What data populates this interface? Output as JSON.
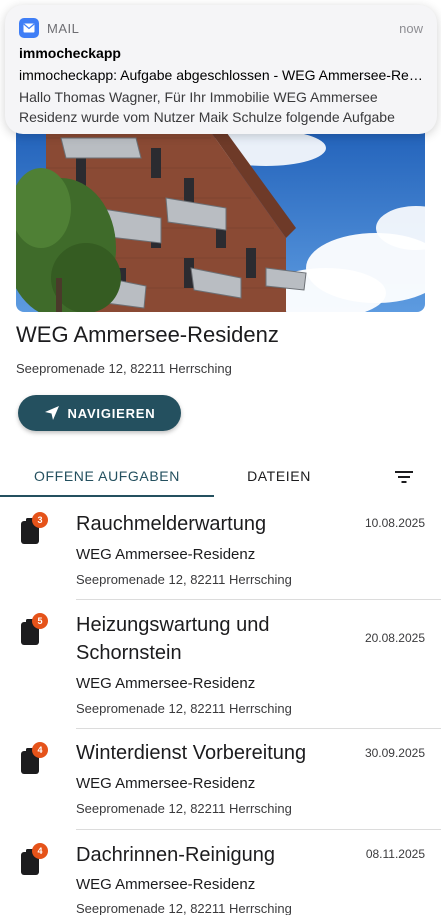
{
  "notification": {
    "app_name": "MAIL",
    "time": "now",
    "sender": "immocheckapp",
    "subject": "immocheckapp: Aufgabe abgeschlossen - WEG Ammersee-Residenz",
    "body": "Hallo Thomas Wagner, Für Ihr Immobilie WEG Ammersee Residenz wurde vom Nutzer Maik Schulze folgende Aufgabe abgeschlossen"
  },
  "property": {
    "name": "WEG Ammersee-Residenz",
    "address": "Seepromenade 12, 82211 Herrsching",
    "navigate_label": "NAVIGIEREN"
  },
  "tabs": {
    "open_tasks": "OFFENE AUFGABEN",
    "files": "DATEIEN"
  },
  "tasks": [
    {
      "title": "Rauchmelderwartung",
      "date": "10.08.2025",
      "property": "WEG Ammersee-Residenz",
      "address": "Seepromenade 12, 82211 Herrsching",
      "badge": "3"
    },
    {
      "title": "Heizungswartung und Schornstein",
      "date": "20.08.2025",
      "property": "WEG Ammersee-Residenz",
      "address": "Seepromenade 12, 82211 Herrsching",
      "badge": "5"
    },
    {
      "title": "Winterdienst Vorbereitung",
      "date": "30.09.2025",
      "property": "WEG Ammersee-Residenz",
      "address": "Seepromenade 12, 82211 Herrsching",
      "badge": "4"
    },
    {
      "title": "Dachrinnen-Reinigung",
      "date": "08.11.2025",
      "property": "WEG Ammersee-Residenz",
      "address": "Seepromenade 12, 82211 Herrsching",
      "badge": "4"
    }
  ],
  "colors": {
    "primary": "#24505f",
    "badge": "#e5531a",
    "mail_icon": "#3f7ef6"
  }
}
